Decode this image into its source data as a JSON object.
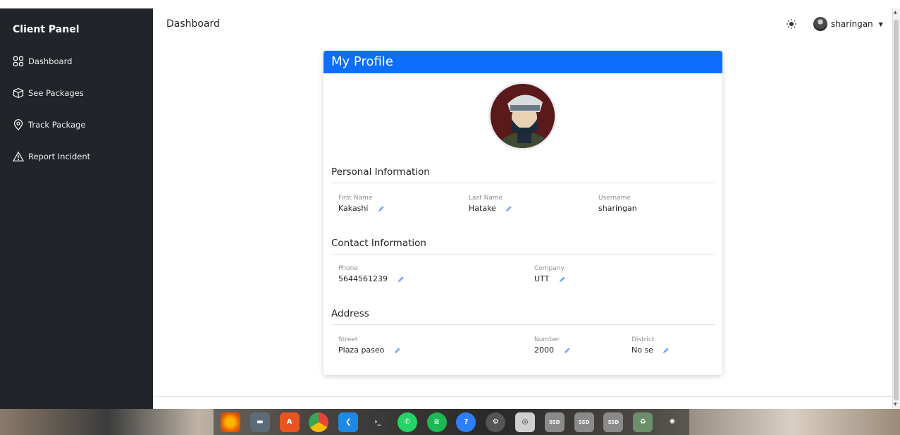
{
  "sidebar": {
    "brand": "Client Panel",
    "items": [
      {
        "label": "Dashboard",
        "icon": "grid-icon"
      },
      {
        "label": "See Packages",
        "icon": "box-icon"
      },
      {
        "label": "Track Package",
        "icon": "location-pin-icon"
      },
      {
        "label": "Report Incident",
        "icon": "warning-icon"
      }
    ]
  },
  "header": {
    "title": "Dashboard",
    "theme_icon": "sun-icon",
    "username": "sharingan"
  },
  "profile": {
    "title": "My Profile",
    "personal": {
      "heading": "Personal Information",
      "first_name_label": "First Name",
      "first_name": "Kakashi",
      "last_name_label": "Last Name",
      "last_name": "Hatake",
      "username_label": "Username",
      "username": "sharingan"
    },
    "contact": {
      "heading": "Contact Information",
      "phone_label": "Phone",
      "phone": "5644561239",
      "company_label": "Company",
      "company": "UTT"
    },
    "address": {
      "heading": "Address",
      "street_label": "Street",
      "street": "Plaza paseo",
      "number_label": "Number",
      "number": "2000",
      "district_label": "District",
      "district": "No se"
    }
  },
  "colors": {
    "sidebar_bg": "#212529",
    "accent": "#0d6efd",
    "pencil": "#6ea8fe"
  },
  "taskbar": {
    "apps": [
      "firefox",
      "files",
      "app-center",
      "chrome",
      "vscode",
      "terminal",
      "whatsapp",
      "spotify",
      "help",
      "settings",
      "screenshot",
      "SSD",
      "SSD",
      "SSD",
      "trash",
      "ubuntu"
    ]
  }
}
